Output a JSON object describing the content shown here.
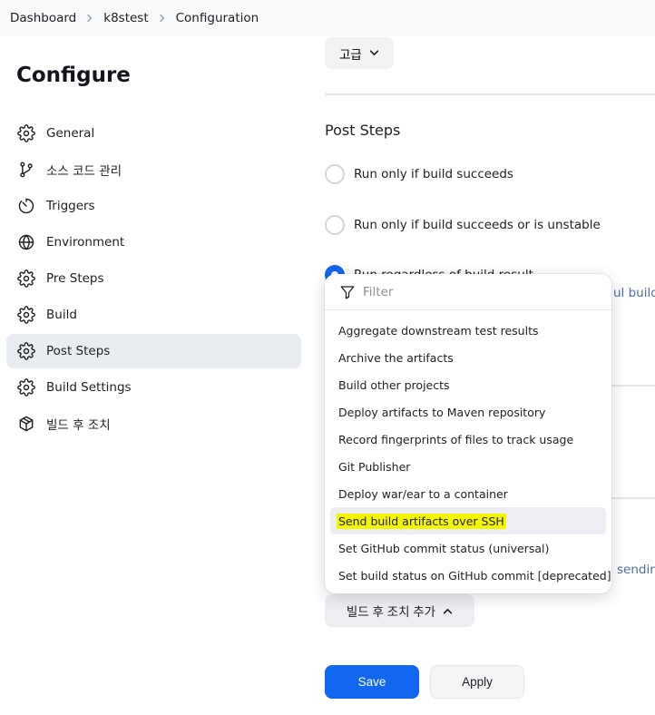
{
  "breadcrumb": [
    "Dashboard",
    "k8stest",
    "Configuration"
  ],
  "sidebar": {
    "title": "Configure",
    "items": [
      {
        "label": "General",
        "icon": "gear-icon"
      },
      {
        "label": "소스 코드 관리",
        "icon": "git-branch-icon"
      },
      {
        "label": "Triggers",
        "icon": "timer-icon"
      },
      {
        "label": "Environment",
        "icon": "globe-icon"
      },
      {
        "label": "Pre Steps",
        "icon": "gear-icon"
      },
      {
        "label": "Build",
        "icon": "gear-icon"
      },
      {
        "label": "Post Steps",
        "icon": "gear-icon",
        "active": true
      },
      {
        "label": "Build Settings",
        "icon": "gear-icon"
      },
      {
        "label": "빌드 후 조치",
        "icon": "package-icon"
      }
    ]
  },
  "main": {
    "advanced_label": "고급",
    "post_steps_title": "Post Steps",
    "radio_options": [
      {
        "label": "Run only if build succeeds",
        "checked": false
      },
      {
        "label": "Run only if build succeeds or is unstable",
        "checked": false
      },
      {
        "label": "Run regardless of build result",
        "checked": true
      }
    ],
    "peek_text_1": "ul builds",
    "peek_text_2": "sendin",
    "add_post_build_label": "빌드 후 조치 추가",
    "save_label": "Save",
    "apply_label": "Apply"
  },
  "dropdown": {
    "filter_placeholder": "Filter",
    "items": [
      "Aggregate downstream test results",
      "Archive the artifacts",
      "Build other projects",
      "Deploy artifacts to Maven repository",
      "Record fingerprints of files to track usage",
      "Git Publisher",
      "Deploy war/ear to a container",
      "Send build artifacts over SSH",
      "Set GitHub commit status (universal)",
      "Set build status on GitHub commit [deprecated]"
    ],
    "highlighted_item": "Send build artifacts over SSH"
  },
  "colors": {
    "accent": "#1167f0",
    "highlight": "#f5f500",
    "active_bg": "#e9ecf1"
  }
}
